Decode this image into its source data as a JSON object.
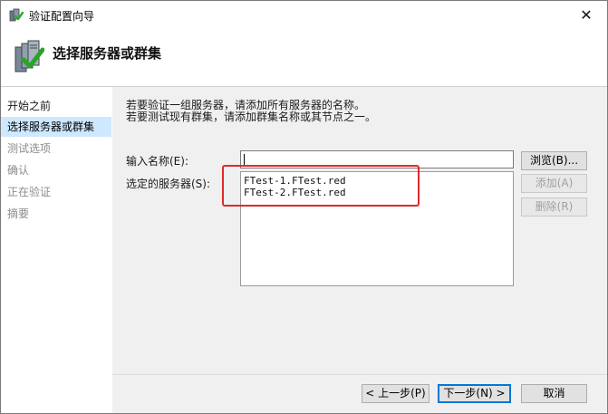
{
  "window": {
    "title": "验证配置向导",
    "close_glyph": "✕"
  },
  "header": {
    "title": "选择服务器或群集"
  },
  "sidebar": {
    "items": [
      {
        "label": "开始之前",
        "state": "normal"
      },
      {
        "label": "选择服务器或群集",
        "state": "active"
      },
      {
        "label": "测试选项",
        "state": "disabled"
      },
      {
        "label": "确认",
        "state": "disabled"
      },
      {
        "label": "正在验证",
        "state": "disabled"
      },
      {
        "label": "摘要",
        "state": "disabled"
      }
    ]
  },
  "main": {
    "intro_line1": "若要验证一组服务器，请添加所有服务器的名称。",
    "intro_line2": "若要测试现有群集，请添加群集名称或其节点之一。",
    "name_label": "输入名称(E):",
    "name_value": "",
    "servers_label": "选定的服务器(S):",
    "servers": [
      "FTest-1.FTest.red",
      "FTest-2.FTest.red"
    ],
    "browse_button": "浏览(B)...",
    "add_button": "添加(A)",
    "remove_button": "删除(R)"
  },
  "footer": {
    "prev_button": "< 上一步(P)",
    "next_button": "下一步(N) >",
    "cancel_button": "取消"
  },
  "colors": {
    "selected_nav": "#cde8ff",
    "panel_bg": "#f0f0f0",
    "annotation_red": "#e02a2a",
    "default_button_border": "#0078d7"
  }
}
